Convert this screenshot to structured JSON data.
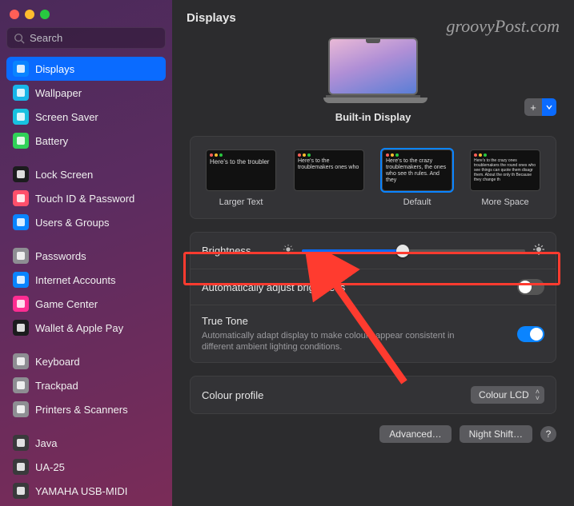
{
  "header": {
    "title": "Displays"
  },
  "watermark": "groovyPost.com",
  "search": {
    "placeholder": "Search"
  },
  "sidebar": {
    "groups": [
      {
        "items": [
          {
            "label": "Displays",
            "icon": "display-icon",
            "color": "#0a84ff",
            "selected": true
          },
          {
            "label": "Wallpaper",
            "icon": "wallpaper-icon",
            "color": "#18b6e9"
          },
          {
            "label": "Screen Saver",
            "icon": "screensaver-icon",
            "color": "#18c1e0"
          },
          {
            "label": "Battery",
            "icon": "battery-icon",
            "color": "#30d158"
          }
        ]
      },
      {
        "items": [
          {
            "label": "Lock Screen",
            "icon": "lock-icon",
            "color": "#1c1c1e"
          },
          {
            "label": "Touch ID & Password",
            "icon": "fingerprint-icon",
            "color": "#ff4f6b"
          },
          {
            "label": "Users & Groups",
            "icon": "users-icon",
            "color": "#0a84ff"
          }
        ]
      },
      {
        "items": [
          {
            "label": "Passwords",
            "icon": "key-icon",
            "color": "#8e8e93"
          },
          {
            "label": "Internet Accounts",
            "icon": "at-icon",
            "color": "#0a84ff"
          },
          {
            "label": "Game Center",
            "icon": "gamecenter-icon",
            "color": "#ff2d92"
          },
          {
            "label": "Wallet & Apple Pay",
            "icon": "wallet-icon",
            "color": "#1c1c1e"
          }
        ]
      },
      {
        "items": [
          {
            "label": "Keyboard",
            "icon": "keyboard-icon",
            "color": "#8e8e93"
          },
          {
            "label": "Trackpad",
            "icon": "trackpad-icon",
            "color": "#8e8e93"
          },
          {
            "label": "Printers & Scanners",
            "icon": "printer-icon",
            "color": "#8e8e93"
          }
        ]
      },
      {
        "items": [
          {
            "label": "Java",
            "icon": "java-icon",
            "color": "#3a3a3c"
          },
          {
            "label": "UA-25",
            "icon": "audio-icon",
            "color": "#3a3a3c"
          },
          {
            "label": "YAMAHA USB-MIDI",
            "icon": "midi-icon",
            "color": "#3a3a3c"
          }
        ]
      }
    ]
  },
  "display": {
    "name": "Built-in Display"
  },
  "scaling": {
    "options": [
      {
        "label": "Larger Text",
        "preview": "Here's to the troubler"
      },
      {
        "label": "",
        "preview": "Here's to the troublemakers ones who"
      },
      {
        "label": "Default",
        "preview": "Here's to the crazy troublemakers, the ones who see th rules. And they",
        "selected": true
      },
      {
        "label": "More Space",
        "preview": "Here's to the crazy ones troublemakers the round ones who see things can quote them disagr them. About the only th Because they change th"
      }
    ]
  },
  "brightness": {
    "label": "Brightness",
    "value": 45
  },
  "autoBrightness": {
    "label": "Automatically adjust brightness",
    "on": false
  },
  "trueTone": {
    "label": "True Tone",
    "description": "Automatically adapt display to make colours appear consistent in different ambient lighting conditions.",
    "on": true
  },
  "colourProfile": {
    "label": "Colour profile",
    "value": "Colour LCD"
  },
  "footer": {
    "advanced": "Advanced…",
    "nightShift": "Night Shift…"
  }
}
